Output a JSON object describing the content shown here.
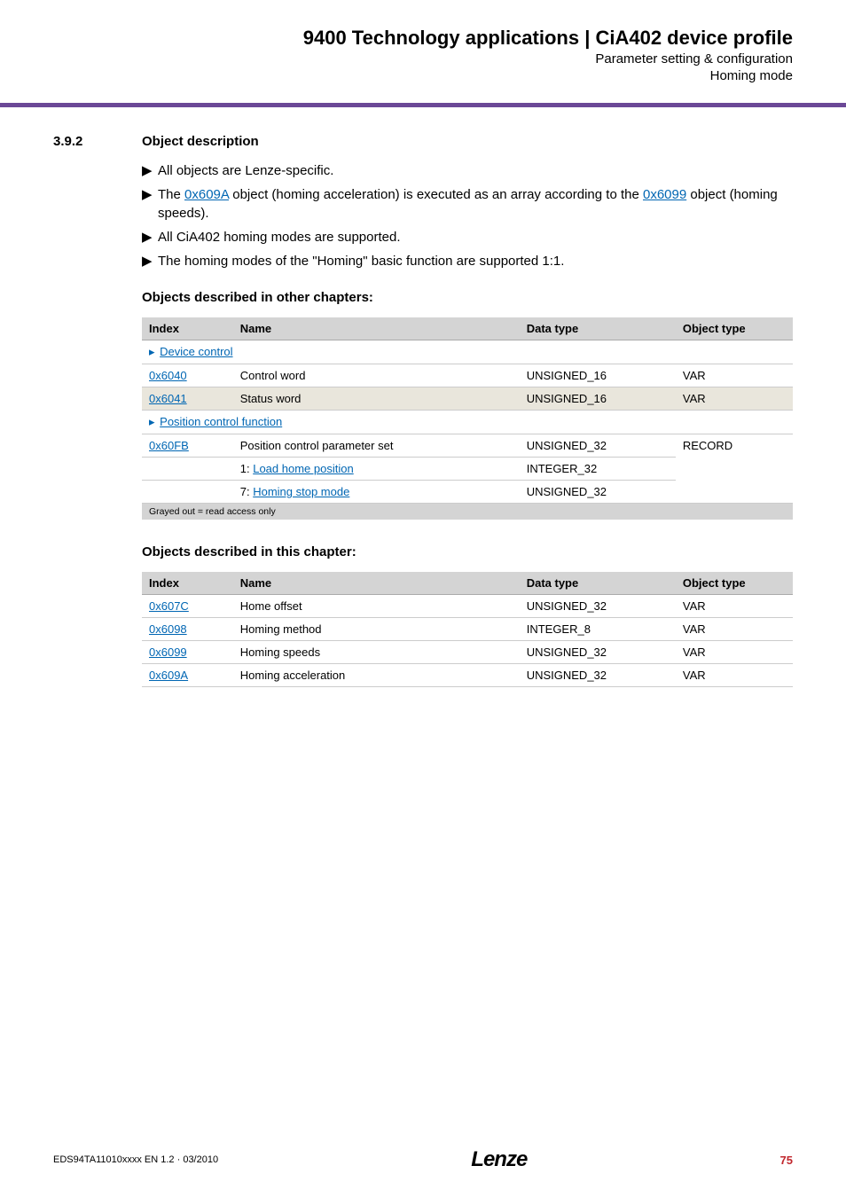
{
  "header": {
    "title": "9400 Technology applications | CiA402 device profile",
    "sub1": "Parameter setting & configuration",
    "sub2": "Homing mode"
  },
  "section": {
    "num": "3.9.2",
    "title": "Object description"
  },
  "bullets": {
    "b1": "All objects are Lenze-specific.",
    "b2a": "The ",
    "b2link1": "0x609A",
    "b2b": " object (homing acceleration) is executed as an array according to the ",
    "b2link2": "0x6099",
    "b2c": " object (homing speeds).",
    "b3": "All CiA402 homing modes are supported.",
    "b4": "The homing modes of the \"Homing\" basic function are supported 1:1."
  },
  "sub1": "Objects described in other chapters:",
  "sub2": "Objects described in this chapter:",
  "th": {
    "index": "Index",
    "name": "Name",
    "dtype": "Data type",
    "otype": "Object type"
  },
  "t1": {
    "g1": "Device control",
    "r1": {
      "idx": "0x6040",
      "name": "Control word",
      "d": "UNSIGNED_16",
      "o": "VAR"
    },
    "r2": {
      "idx": "0x6041",
      "name": "Status word",
      "d": "UNSIGNED_16",
      "o": "VAR"
    },
    "g2": "Position control function",
    "r3": {
      "idx": "0x60FB",
      "name": "Position control parameter set",
      "d": "UNSIGNED_32",
      "o": "RECORD"
    },
    "r4": {
      "pre": "1: ",
      "name": "Load home position",
      "d": "INTEGER_32"
    },
    "r5": {
      "pre": "7: ",
      "name": "Homing stop mode",
      "d": "UNSIGNED_32"
    },
    "note": "Grayed out = read access only"
  },
  "t2": {
    "r1": {
      "idx": "0x607C",
      "name": "Home offset",
      "d": "UNSIGNED_32",
      "o": "VAR"
    },
    "r2": {
      "idx": "0x6098",
      "name": "Homing method",
      "d": "INTEGER_8",
      "o": "VAR"
    },
    "r3": {
      "idx": "0x6099",
      "name": "Homing speeds",
      "d": "UNSIGNED_32",
      "o": "VAR"
    },
    "r4": {
      "idx": "0x609A",
      "name": "Homing acceleration",
      "d": "UNSIGNED_32",
      "o": "VAR"
    }
  },
  "footer": {
    "doc": "EDS94TA11010xxxx EN 1.2 · 03/2010",
    "logo": "Lenze",
    "page": "75"
  }
}
